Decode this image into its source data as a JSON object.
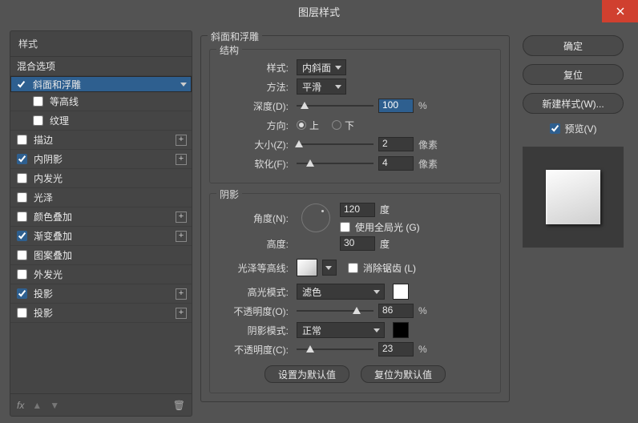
{
  "title": "图层样式",
  "left": {
    "styles": "样式",
    "blend": "混合选项",
    "items": [
      {
        "label": "斜面和浮雕",
        "checked": true,
        "selected": true,
        "plus": false
      },
      {
        "label": "等高线",
        "checked": false,
        "sub": true
      },
      {
        "label": "纹理",
        "checked": false,
        "sub": true
      },
      {
        "label": "描边",
        "checked": false,
        "plus": true
      },
      {
        "label": "内阴影",
        "checked": true,
        "plus": true
      },
      {
        "label": "内发光",
        "checked": false
      },
      {
        "label": "光泽",
        "checked": false
      },
      {
        "label": "颜色叠加",
        "checked": false,
        "plus": true
      },
      {
        "label": "渐变叠加",
        "checked": true,
        "plus": true
      },
      {
        "label": "图案叠加",
        "checked": false
      },
      {
        "label": "外发光",
        "checked": false
      },
      {
        "label": "投影",
        "checked": true,
        "plus": true
      },
      {
        "label": "投影",
        "checked": false,
        "plus": true
      }
    ],
    "fx": "fx"
  },
  "mid": {
    "group_title": "斜面和浮雕",
    "struct_title": "结构",
    "style_lab": "样式:",
    "style_val": "内斜面",
    "technique_lab": "方法:",
    "technique_val": "平滑",
    "depth_lab": "深度(D):",
    "depth_val": "100",
    "pct": "%",
    "dir_lab": "方向:",
    "dir_up": "上",
    "dir_down": "下",
    "size_lab": "大小(Z):",
    "size_val": "2",
    "px": "像素",
    "soften_lab": "软化(F):",
    "soften_val": "4",
    "shade_title": "阴影",
    "angle_lab": "角度(N):",
    "angle_val": "120",
    "deg": "度",
    "global_lab": "使用全局光 (G)",
    "alt_lab": "高度:",
    "alt_val": "30",
    "gloss_lab": "光泽等高线:",
    "aa_lab": "消除锯齿 (L)",
    "hl_mode_lab": "高光模式:",
    "hl_mode_val": "滤色",
    "hl_op_lab": "不透明度(O):",
    "hl_op_val": "86",
    "sh_mode_lab": "阴影模式:",
    "sh_mode_val": "正常",
    "sh_op_lab": "不透明度(C):",
    "sh_op_val": "23",
    "btn_default": "设置为默认值",
    "btn_reset": "复位为默认值"
  },
  "right": {
    "ok": "确定",
    "cancel": "复位",
    "new_style": "新建样式(W)...",
    "preview": "预览(V)"
  }
}
